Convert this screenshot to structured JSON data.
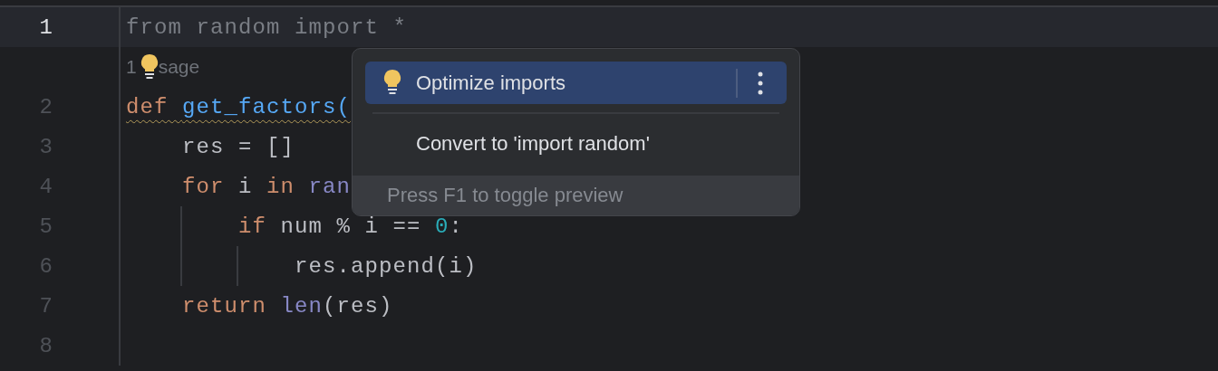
{
  "editor": {
    "lines": [
      {
        "number": "1",
        "current": true,
        "tokens": [
          {
            "kind": "unused",
            "text": "from random import *"
          }
        ]
      },
      {
        "kind": "inlay",
        "before": "1",
        "after": "sage"
      },
      {
        "number": "2",
        "current": false,
        "squiggle": true,
        "tokens": [
          {
            "kind": "keyword",
            "text": "def "
          },
          {
            "kind": "function",
            "text": "get_factors("
          }
        ]
      },
      {
        "number": "3",
        "current": false,
        "tokens": [
          {
            "kind": "plain",
            "text": "    res = []"
          }
        ]
      },
      {
        "number": "4",
        "current": false,
        "tokens": [
          {
            "kind": "keyword",
            "text": "    for "
          },
          {
            "kind": "plain",
            "text": "i "
          },
          {
            "kind": "keyword",
            "text": "in "
          },
          {
            "kind": "builtin",
            "text": "ran"
          }
        ]
      },
      {
        "number": "5",
        "current": false,
        "tokens": [
          {
            "kind": "keyword",
            "text": "        if "
          },
          {
            "kind": "plain",
            "text": "num % i == "
          },
          {
            "kind": "number",
            "text": "0"
          },
          {
            "kind": "plain",
            "text": ":"
          }
        ]
      },
      {
        "number": "6",
        "current": false,
        "tokens": [
          {
            "kind": "plain",
            "text": "            res.append(i)"
          }
        ]
      },
      {
        "number": "7",
        "current": false,
        "tokens": [
          {
            "kind": "keyword",
            "text": "    return "
          },
          {
            "kind": "builtin",
            "text": "len"
          },
          {
            "kind": "plain",
            "text": "(res)"
          }
        ]
      },
      {
        "number": "8",
        "current": false
      }
    ]
  },
  "popup": {
    "items": [
      {
        "label": "Optimize imports",
        "selected": true,
        "bulb": true
      },
      {
        "label": "Convert to 'import random'",
        "selected": false,
        "bulb": false
      }
    ],
    "footer": "Press F1 to toggle preview"
  }
}
